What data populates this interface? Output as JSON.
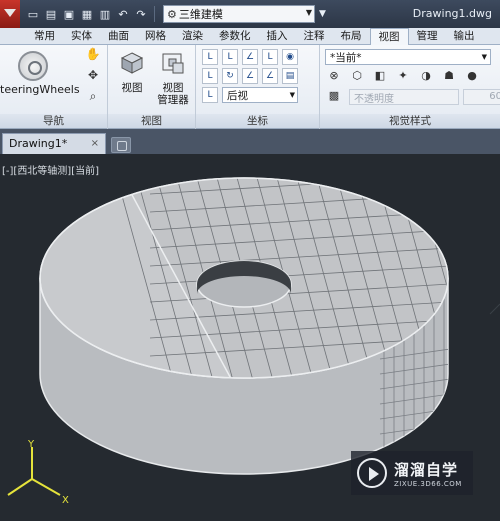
{
  "titlebar": {
    "workspace": "三维建模",
    "document_title": "Drawing1.dwg"
  },
  "tabs": [
    "常用",
    "实体",
    "曲面",
    "网格",
    "渲染",
    "参数化",
    "插入",
    "注释",
    "布局",
    "视图",
    "管理",
    "输出"
  ],
  "active_tab": "视图",
  "ribbon": {
    "navigation": {
      "steering_label": "teeringWheels",
      "panel_label": "导航"
    },
    "views": {
      "view_label": "视图",
      "manager_label_1": "视图",
      "manager_label_2": "管理器",
      "panel_label": "视图"
    },
    "coordinates": {
      "view_combo": "后视",
      "panel_label": "坐标"
    },
    "visual_styles": {
      "current_style": "*当前*",
      "opacity_placeholder": "不透明度",
      "opacity_value": "60",
      "panel_label": "视觉样式"
    }
  },
  "document_tab": {
    "name": "Drawing1*",
    "close": "×"
  },
  "viewport": {
    "label": "[-][西北等轴测][当前]"
  },
  "ucs": {
    "y": "Y",
    "x": "X"
  },
  "watermark": {
    "main": "溜溜自学",
    "sub": "ZIXUE.3D66.COM"
  }
}
